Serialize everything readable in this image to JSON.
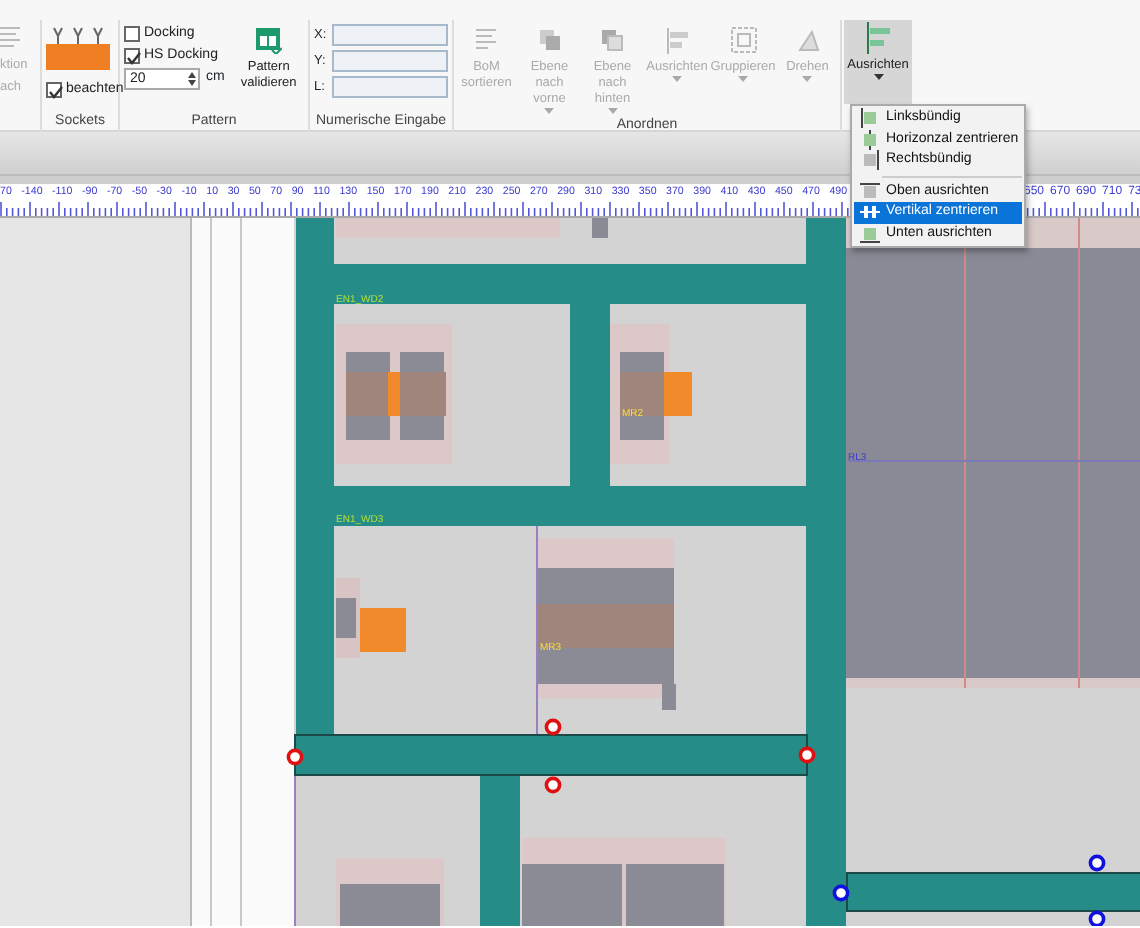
{
  "ribbon": {
    "partial_group": {
      "lines": [
        "ktion",
        "ach"
      ]
    },
    "sockets": {
      "checkbox": {
        "label": "beachten",
        "checked": true
      },
      "group_label": "Sockets"
    },
    "pattern": {
      "checkboxes": [
        {
          "label": "Docking",
          "checked": false
        },
        {
          "label": "HS Docking",
          "checked": true
        }
      ],
      "spinner": {
        "value": "20",
        "unit": "cm"
      },
      "validate_button": "Pattern validieren",
      "group_label": "Pattern"
    },
    "numeric_input": {
      "fields": [
        {
          "label": "X:"
        },
        {
          "label": "Y:"
        },
        {
          "label": "L:"
        }
      ],
      "group_label": "Numerische Eingabe"
    },
    "arrange": {
      "buttons": [
        {
          "label": "BoM sortieren",
          "disabled": true,
          "dropdown": false
        },
        {
          "label": "Ebene nach vorne",
          "disabled": true,
          "dropdown": true
        },
        {
          "label": "Ebene nach hinten",
          "disabled": true,
          "dropdown": true
        },
        {
          "label": "Ausrichten",
          "disabled": true,
          "dropdown": true
        },
        {
          "label": "Gruppieren",
          "disabled": true,
          "dropdown": true
        },
        {
          "label": "Drehen",
          "disabled": true,
          "dropdown": true
        }
      ],
      "group_label": "Anordnen"
    },
    "align_button": {
      "label": "Ausrichten",
      "pressed": true,
      "dropdown": true
    }
  },
  "align_menu": [
    {
      "kind": "item",
      "label": "Linksbündig",
      "selected": false
    },
    {
      "kind": "item",
      "label": "Horizonzal zentrieren",
      "selected": false
    },
    {
      "kind": "item",
      "label": "Rechtsbündig",
      "selected": false
    },
    {
      "kind": "separator"
    },
    {
      "kind": "item",
      "label": "Oben ausrichten",
      "selected": false
    },
    {
      "kind": "item",
      "label": "Vertikal zentrieren",
      "selected": true
    },
    {
      "kind": "item",
      "label": "Unten ausrichten",
      "selected": false
    }
  ],
  "ruler": {
    "left_labels": [
      "70",
      "-140",
      "-110",
      "-90",
      "-70",
      "-50",
      "-30",
      "-10",
      "10",
      "30",
      "50",
      "70",
      "90",
      "110",
      "130",
      "150",
      "170",
      "190",
      "210",
      "230",
      "250",
      "270",
      "290",
      "310",
      "330",
      "350",
      "370",
      "390",
      "410",
      "430",
      "450",
      "470",
      "490"
    ],
    "right_labels": [
      "650",
      "670",
      "690",
      "710",
      "73"
    ]
  },
  "canvas_labels": [
    {
      "text": "EN1_WD2",
      "kind": "wall"
    },
    {
      "text": "EN1_WD3",
      "kind": "wall"
    },
    {
      "text": "MR2",
      "kind": "module"
    },
    {
      "text": "MR3",
      "kind": "module"
    },
    {
      "text": "RL3",
      "kind": "line"
    }
  ]
}
